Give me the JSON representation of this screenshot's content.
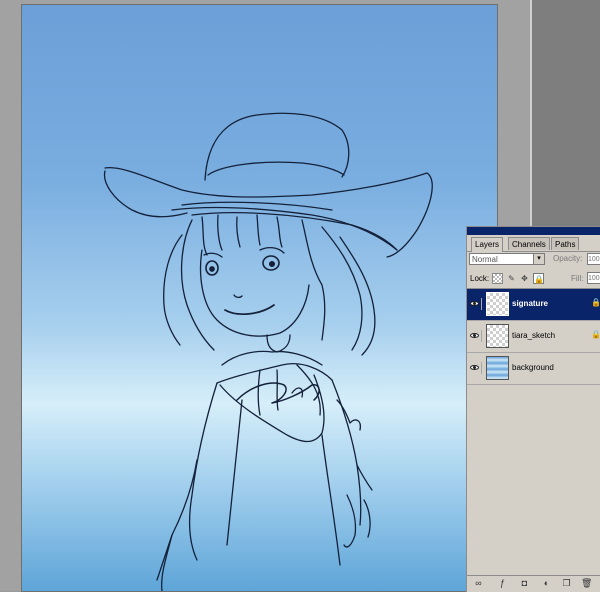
{
  "layers_panel": {
    "tabs": [
      {
        "label": "Layers",
        "active": true
      },
      {
        "label": "Channels",
        "active": false
      },
      {
        "label": "Paths",
        "active": false
      }
    ],
    "blend_mode": "Normal",
    "opacity_label": "Opacity:",
    "opacity_value": "100",
    "lock_label": "Lock:",
    "fill_label": "Fill:",
    "fill_value": "100",
    "layers": [
      {
        "name": "signature",
        "selected": true,
        "visible": true,
        "locked": true,
        "thumb": "transparent"
      },
      {
        "name": "tiara_sketch",
        "selected": false,
        "visible": true,
        "locked": true,
        "thumb": "transparent"
      },
      {
        "name": "background",
        "selected": false,
        "visible": true,
        "locked": false,
        "thumb": "gradient"
      }
    ],
    "selection_color": "#0a246a"
  },
  "icons": {
    "lock_transparency": "checker-lock-icon",
    "lock_paint": "brush-icon",
    "lock_move": "move-icon",
    "lock_all": "lock-icon",
    "visibility": "eye-icon",
    "footer": [
      "link-icon",
      "fx-icon",
      "mask-icon",
      "adjustment-icon",
      "new-layer-icon",
      "trash-icon"
    ]
  }
}
